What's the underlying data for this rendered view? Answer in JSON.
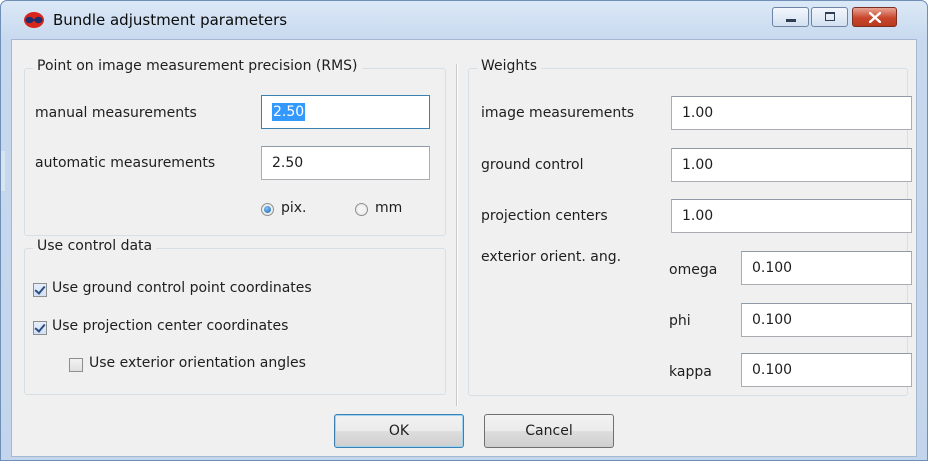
{
  "window": {
    "title": "Bundle adjustment parameters",
    "icon": "app-logo-icon",
    "controls": [
      "minimize-icon",
      "restore-icon",
      "close-icon"
    ]
  },
  "precision": {
    "title": "Point on image measurement precision (RMS)",
    "manual_label": "manual measurements",
    "manual_value": "2.50",
    "automatic_label": "automatic measurements",
    "automatic_value": "2.50",
    "unit_pix": "pix.",
    "unit_mm": "mm",
    "selected_unit": "pix."
  },
  "control": {
    "title": "Use control data",
    "gcp_label": "Use ground control point coordinates",
    "gcp_checked": true,
    "proj_label": "Use projection center coordinates",
    "proj_checked": true,
    "eo_label": "Use exterior orientation angles",
    "eo_checked": false
  },
  "weights": {
    "title": "Weights",
    "image_label": "image measurements",
    "image_value": "1.00",
    "ground_label": "ground control",
    "ground_value": "1.00",
    "proj_label": "projection centers",
    "proj_value": "1.00",
    "ext_label": "exterior orient. ang.",
    "omega_label": "omega",
    "omega_value": "0.100",
    "phi_label": "phi",
    "phi_value": "0.100",
    "kappa_label": "kappa",
    "kappa_value": "0.100"
  },
  "buttons": {
    "ok": "OK",
    "cancel": "Cancel"
  },
  "colors": {
    "title_gradient_top": "#dbe8f6",
    "close_button": "#c8462c",
    "selection": "#3399ff",
    "focus_border": "#3c7fb1"
  }
}
